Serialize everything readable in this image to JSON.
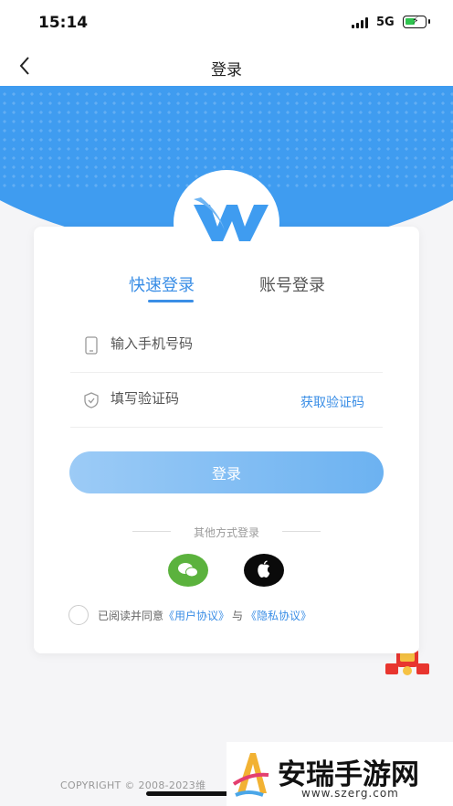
{
  "status": {
    "time": "15:14",
    "network": "5G"
  },
  "nav": {
    "title": "登录",
    "back_icon": "chevron-left-icon"
  },
  "tabs": [
    {
      "label": "快速登录",
      "active": true
    },
    {
      "label": "账号登录",
      "active": false
    }
  ],
  "form": {
    "phone_placeholder": "输入手机号码",
    "code_placeholder": "填写验证码",
    "get_code": "获取验证码",
    "login_button": "登录"
  },
  "other_login": {
    "label": "其他方式登录",
    "icons": [
      "wechat-icon",
      "apple-icon"
    ]
  },
  "agreement": {
    "prefix": "已阅读并同意",
    "user_agreement": "《用户协议》",
    "and": "与",
    "privacy": "《隐私协议》"
  },
  "footer": {
    "copyright": "COPYRIGHT © 2008-2023维"
  },
  "watermark": {
    "title": "安瑞手游网",
    "url": "www.szerg.com"
  },
  "colors": {
    "accent": "#3a8ee6",
    "hero": "#3f9cf0",
    "wechat": "#5bb23d"
  }
}
